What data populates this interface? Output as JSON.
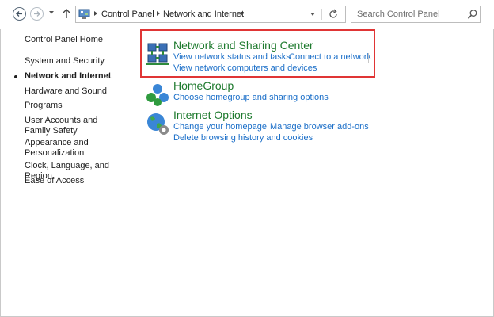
{
  "nav": {
    "back_icon": "back-arrow-icon",
    "forward_icon": "forward-arrow-icon",
    "recent_icon": "chevron-down-icon",
    "up_icon": "up-arrow-icon"
  },
  "address": {
    "icon": "control-panel-icon",
    "crumbs": [
      "Control Panel",
      "Network and Internet"
    ],
    "refresh_icon": "refresh-icon"
  },
  "search": {
    "placeholder": "Search Control Panel",
    "icon": "search-icon"
  },
  "sidebar": {
    "items": [
      {
        "label": "Control Panel Home"
      },
      {
        "label": "System and Security"
      },
      {
        "label": "Network and Internet",
        "active": true
      },
      {
        "label": "Hardware and Sound"
      },
      {
        "label": "Programs"
      },
      {
        "label": "User Accounts and Family Safety"
      },
      {
        "label": "Appearance and Personalization"
      },
      {
        "label": "Clock, Language, and Region"
      },
      {
        "label": "Ease of Access"
      }
    ]
  },
  "categories": [
    {
      "title": "Network and Sharing Center",
      "icon": "network-sharing-center-icon",
      "links": [
        "View network status and tasks",
        "Connect to a network",
        "View network computers and devices"
      ],
      "highlighted": true
    },
    {
      "title": "HomeGroup",
      "icon": "homegroup-icon",
      "links": [
        "Choose homegroup and sharing options"
      ]
    },
    {
      "title": "Internet Options",
      "icon": "internet-options-icon",
      "links": [
        "Change your homepage",
        "Manage browser add-ons",
        "Delete browsing history and cookies"
      ]
    }
  ],
  "colors": {
    "category_title": "#1e7a2e",
    "link": "#1a6ec8",
    "highlight": "#e03535"
  }
}
